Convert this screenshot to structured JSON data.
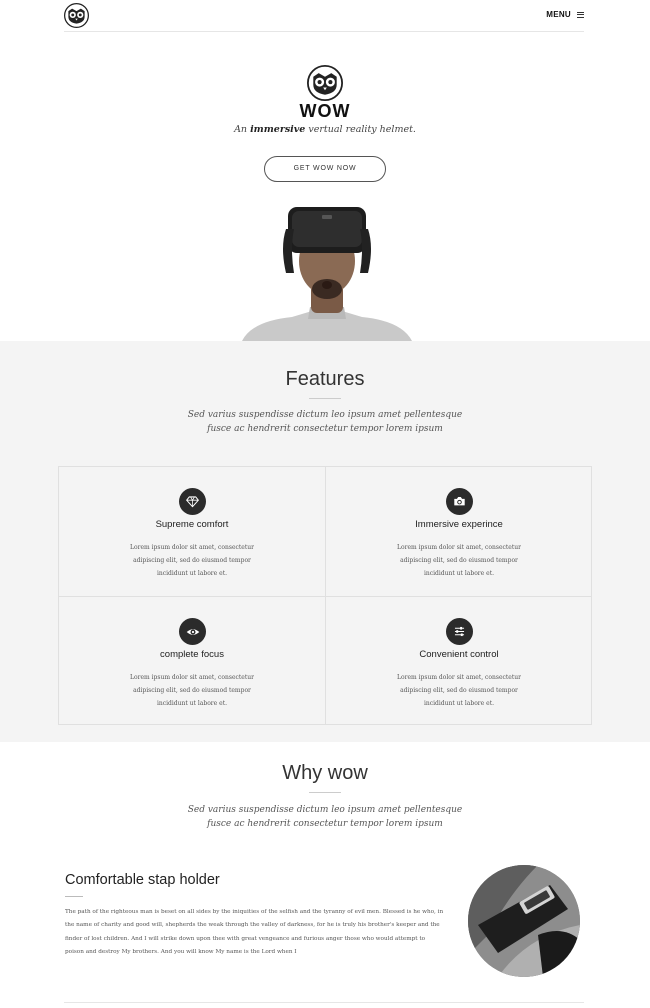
{
  "header": {
    "menu_label": "MENU"
  },
  "hero": {
    "brand": "WOW",
    "tagline_prefix": "An ",
    "tagline_emphasis": "immersive",
    "tagline_suffix": " vertual reality helmet.",
    "cta_label": "GET WOW NOW"
  },
  "features": {
    "title": "Features",
    "subtitle_line1": "Sed varius suspendisse dictum leo ipsum amet pellentesque",
    "subtitle_line2": "fusce ac hendrerit consectetur tempor lorem ipsum",
    "items": [
      {
        "icon": "diamond-icon",
        "title": "Supreme comfort",
        "body": "Lorem ipsum dolor sit amet, consectetur adipiscing elit, sed do eiusmod tempor incididunt ut labore et."
      },
      {
        "icon": "camera-icon",
        "title": "Immersive experince",
        "body": "Lorem ipsum dolor sit amet, consectetur adipiscing elit, sed do eiusmod tempor incididunt ut labore et."
      },
      {
        "icon": "eye-icon",
        "title": "complete focus",
        "body": "Lorem ipsum dolor sit amet, consectetur adipiscing elit, sed do eiusmod tempor incididunt ut labore et."
      },
      {
        "icon": "sliders-icon",
        "title": "Convenient control",
        "body": "Lorem ipsum dolor sit amet, consectetur adipiscing elit, sed do eiusmod tempor incididunt ut labore et."
      }
    ]
  },
  "why": {
    "title": "Why wow",
    "subtitle_line1": "Sed varius suspendisse dictum leo ipsum amet pellentesque",
    "subtitle_line2": "fusce ac hendrerit consectetur tempor lorem ipsum",
    "stap_title": "Comfortable stap holder",
    "stap_body": "The path of the righteous man is beset on all sides by the iniquities of the selfish and the tyranny of evil men. Blessed is he who, in the name of charity and good will, shepherds the weak through the valley of darkness, for he is truly his brother's keeper and the finder of lost children. And I will strike down upon thee with great vengeance and furious anger those who would attempt to poison and destroy My brothers. And you will know My name is the Lord when I"
  },
  "colors": {
    "dark": "#2b2b2b",
    "features_bg": "#f4f4f4",
    "rule": "#e0e0e0"
  }
}
